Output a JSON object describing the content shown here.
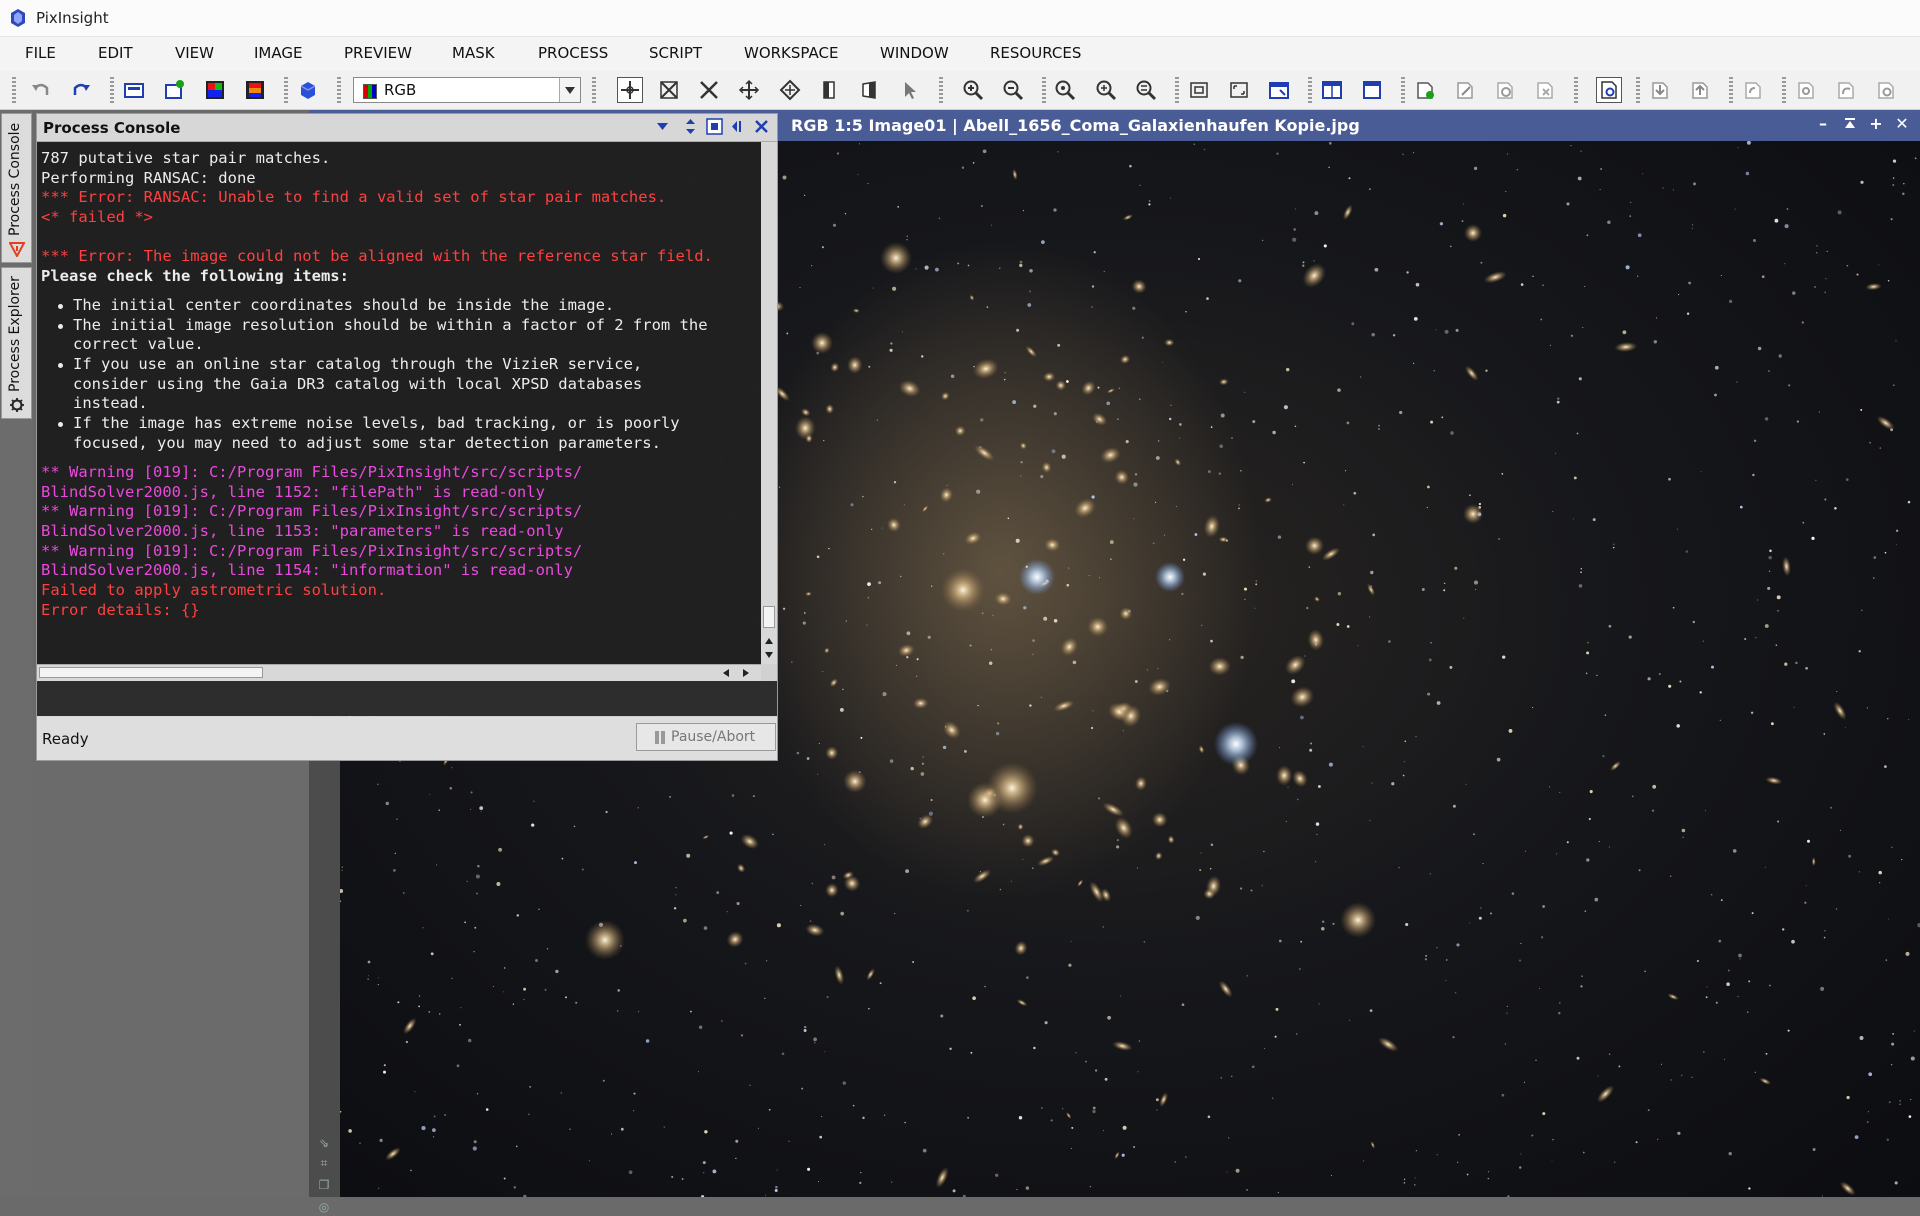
{
  "app": {
    "title": "PixInsight"
  },
  "menu": [
    "FILE",
    "EDIT",
    "VIEW",
    "IMAGE",
    "PREVIEW",
    "MASK",
    "PROCESS",
    "SCRIPT",
    "WORKSPACE",
    "WINDOW",
    "RESOURCES"
  ],
  "toolbar": {
    "colorspace": "RGB"
  },
  "side_tabs": {
    "process_console": "Process Console",
    "process_explorer": "Process Explorer"
  },
  "console": {
    "title": "Process Console",
    "lines": {
      "l1": "787 putative star pair matches.",
      "l2": "Performing RANSAC: done",
      "l3": "*** Error: RANSAC: Unable to find a valid set of star pair matches.",
      "l4": "<* failed *>",
      "l5": "*** Error: The image could not be aligned with the reference star field.",
      "l6": "Please check the following items:",
      "b1a": "The initial center coordinates should be inside the image.",
      "b2a": "The initial image resolution should be within a factor of 2 from the",
      "b2b": "correct value.",
      "b3a": "If you use an online star catalog through the VizieR service,",
      "b3b": "consider using the Gaia DR3 catalog with local XPSD databases",
      "b3c": "instead.",
      "b4a": "If the image has extreme noise levels, bad tracking, or is poorly",
      "b4b": "focused, you may need to adjust some star detection parameters.",
      "w1a": "** Warning [019]: C:/Program Files/PixInsight/src/scripts/",
      "w1b": "BlindSolver2000.js, line 1152: \"filePath\" is read-only",
      "w2a": "** Warning [019]: C:/Program Files/PixInsight/src/scripts/",
      "w2b": "BlindSolver2000.js, line 1153: \"parameters\" is read-only",
      "w3a": "** Warning [019]: C:/Program Files/PixInsight/src/scripts/",
      "w3b": "BlindSolver2000.js, line 1154: \"information\" is read-only",
      "f1": "Failed to apply astrometric solution.",
      "f2": "Error details: {}"
    },
    "status": "Ready",
    "pause_abort": "Pause/Abort",
    "colors": {
      "error": "#ff4040",
      "warning": "#ea49de",
      "text": "#ececec"
    }
  },
  "image_window": {
    "title": "RGB 1:5 Image01 | Abell_1656_Coma_Galaxienhaufen Kopie.jpg",
    "titlebar_color": "#4a5c95"
  }
}
